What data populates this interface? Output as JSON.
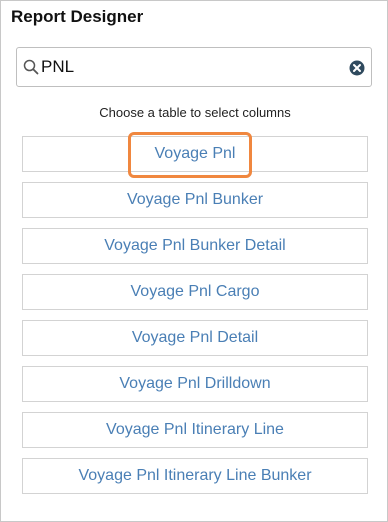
{
  "panel": {
    "title": "Report Designer"
  },
  "search": {
    "value": "PNL"
  },
  "hint": "Choose a table to select columns",
  "tables": [
    "Voyage Pnl",
    "Voyage Pnl Bunker",
    "Voyage Pnl Bunker Detail",
    "Voyage Pnl Cargo",
    "Voyage Pnl Detail",
    "Voyage Pnl Drilldown",
    "Voyage Pnl Itinerary Line",
    "Voyage Pnl Itinerary Line Bunker"
  ],
  "colors": {
    "link": "#4a7fb5",
    "highlight": "#f0873f",
    "clear_icon": "#2f4a5e"
  },
  "icons": {
    "search": "magnifier-icon",
    "clear": "close-circle-icon"
  }
}
